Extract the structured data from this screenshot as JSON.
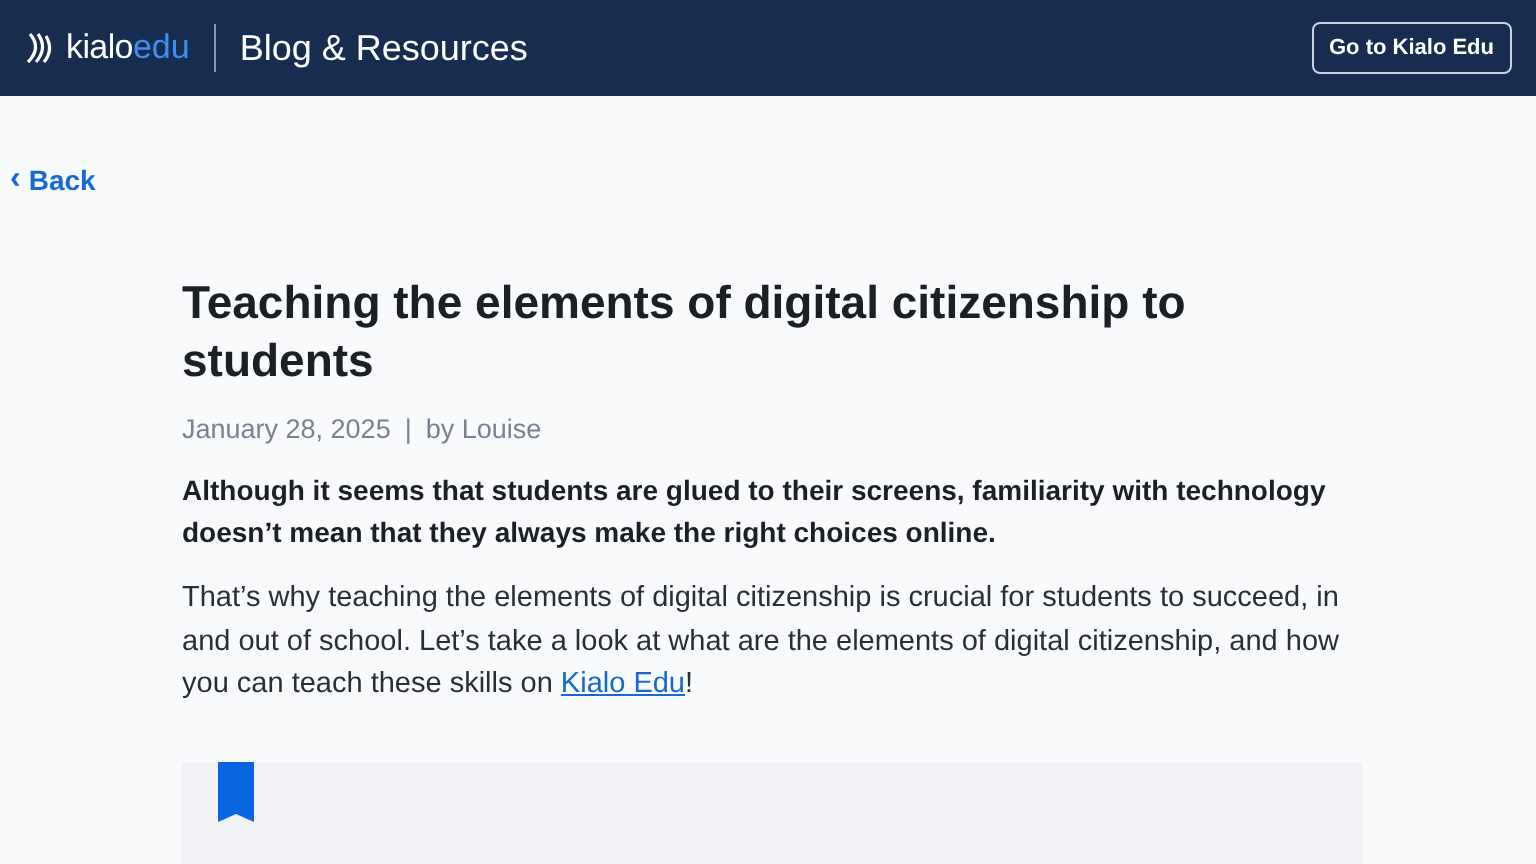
{
  "header": {
    "logo": {
      "word": "kialo",
      "suffix": "edu"
    },
    "section": "Blog & Resources",
    "cta": "Go to Kialo Edu"
  },
  "back": {
    "icon": "‹",
    "label": "Back"
  },
  "article": {
    "title": "Teaching the elements of digital citizenship to students",
    "date": "January 28, 2025",
    "separator": "|",
    "author": "by Louise",
    "lead": "Although it seems that students are glued to their screens, familiarity with technology doesn’t mean that they always make the right choices online.",
    "body": {
      "before": "That’s why teaching the elements of digital citizenship is crucial for students to succeed, in and out of school. Let’s take a look at what are the elements of digital citizenship, and how you can teach these skills on ",
      "link": "Kialo Edu",
      "after": "!"
    }
  }
}
